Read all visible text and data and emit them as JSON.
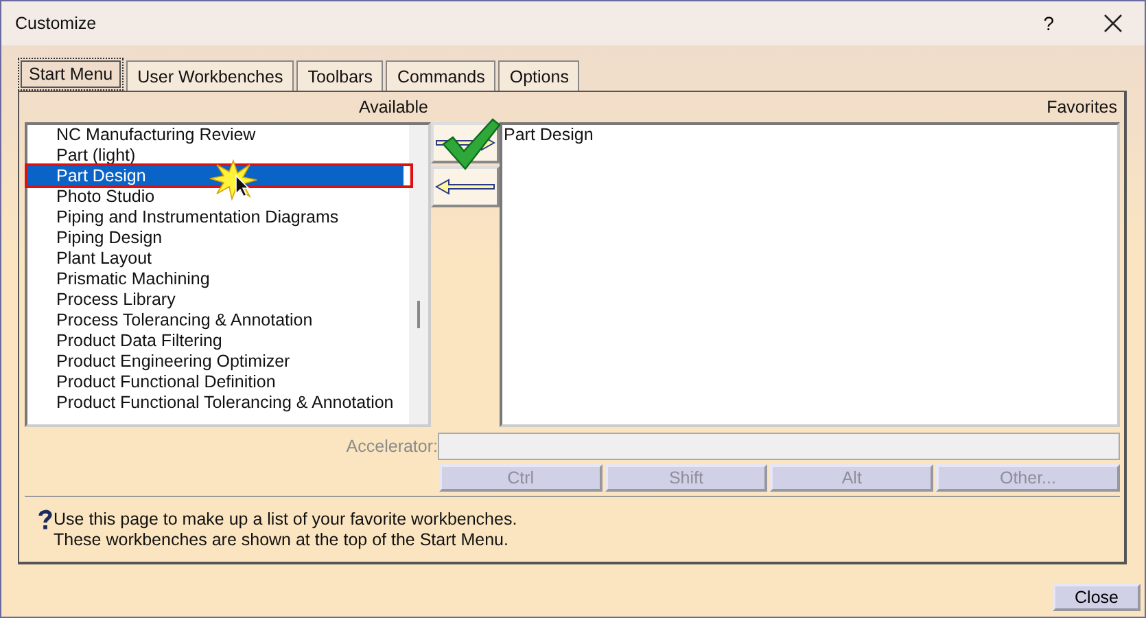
{
  "window": {
    "title": "Customize",
    "help_button": "?"
  },
  "tabs": [
    {
      "label": "Start Menu",
      "selected": true
    },
    {
      "label": "User Workbenches",
      "selected": false
    },
    {
      "label": "Toolbars",
      "selected": false
    },
    {
      "label": "Commands",
      "selected": false
    },
    {
      "label": "Options",
      "selected": false
    }
  ],
  "available": {
    "heading": "Available",
    "items": [
      {
        "label": "NC Manufacturing Review",
        "selected": false
      },
      {
        "label": "Part (light)",
        "selected": false
      },
      {
        "label": "Part Design",
        "selected": true
      },
      {
        "label": "Photo Studio",
        "selected": false
      },
      {
        "label": "Piping and Instrumentation Diagrams",
        "selected": false
      },
      {
        "label": "Piping Design",
        "selected": false
      },
      {
        "label": "Plant Layout",
        "selected": false
      },
      {
        "label": "Prismatic Machining",
        "selected": false
      },
      {
        "label": "Process Library",
        "selected": false
      },
      {
        "label": "Process Tolerancing & Annotation",
        "selected": false
      },
      {
        "label": "Product Data Filtering",
        "selected": false
      },
      {
        "label": "Product Engineering Optimizer",
        "selected": false
      },
      {
        "label": "Product Functional Definition",
        "selected": false
      },
      {
        "label": "Product Functional Tolerancing & Annotation",
        "selected": false
      }
    ]
  },
  "favorites": {
    "heading": "Favorites",
    "items": [
      {
        "label": "Part Design",
        "selected": false
      }
    ]
  },
  "accelerator": {
    "label": "Accelerator:",
    "disabled": true
  },
  "modifier_buttons": [
    {
      "label": "Ctrl",
      "disabled": true
    },
    {
      "label": "Shift",
      "disabled": true
    },
    {
      "label": "Alt",
      "disabled": true
    },
    {
      "label": "Other...",
      "disabled": true
    }
  ],
  "help_text": "Use this page to make up a list of your favorite workbenches.\nThese workbenches are shown at the top of the Start Menu.",
  "close_button": "Close"
}
